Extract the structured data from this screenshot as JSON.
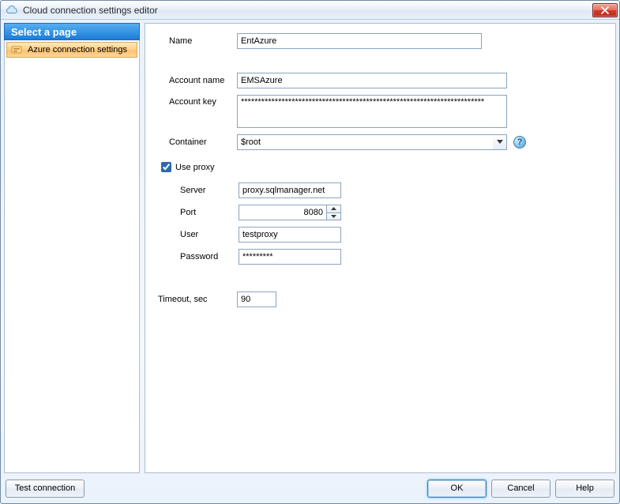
{
  "window": {
    "title": "Cloud connection settings editor"
  },
  "sidebar": {
    "header": "Select a page",
    "items": [
      {
        "label": "Azure connection settings"
      }
    ]
  },
  "form": {
    "name_label": "Name",
    "name_value": "EntAzure",
    "account_name_label": "Account name",
    "account_name_value": "EMSAzure",
    "account_key_label": "Account key",
    "account_key_value": "************************************************************************",
    "container_label": "Container",
    "container_value": "$root",
    "use_proxy_label": "Use proxy",
    "use_proxy_checked": true,
    "proxy": {
      "server_label": "Server",
      "server_value": "proxy.sqlmanager.net",
      "port_label": "Port",
      "port_value": "8080",
      "user_label": "User",
      "user_value": "testproxy",
      "password_label": "Password",
      "password_value": "*********"
    },
    "timeout_label": "Timeout, sec",
    "timeout_value": "90"
  },
  "buttons": {
    "test": "Test connection",
    "ok": "OK",
    "cancel": "Cancel",
    "help": "Help"
  },
  "icons": {
    "help_glyph": "?"
  }
}
